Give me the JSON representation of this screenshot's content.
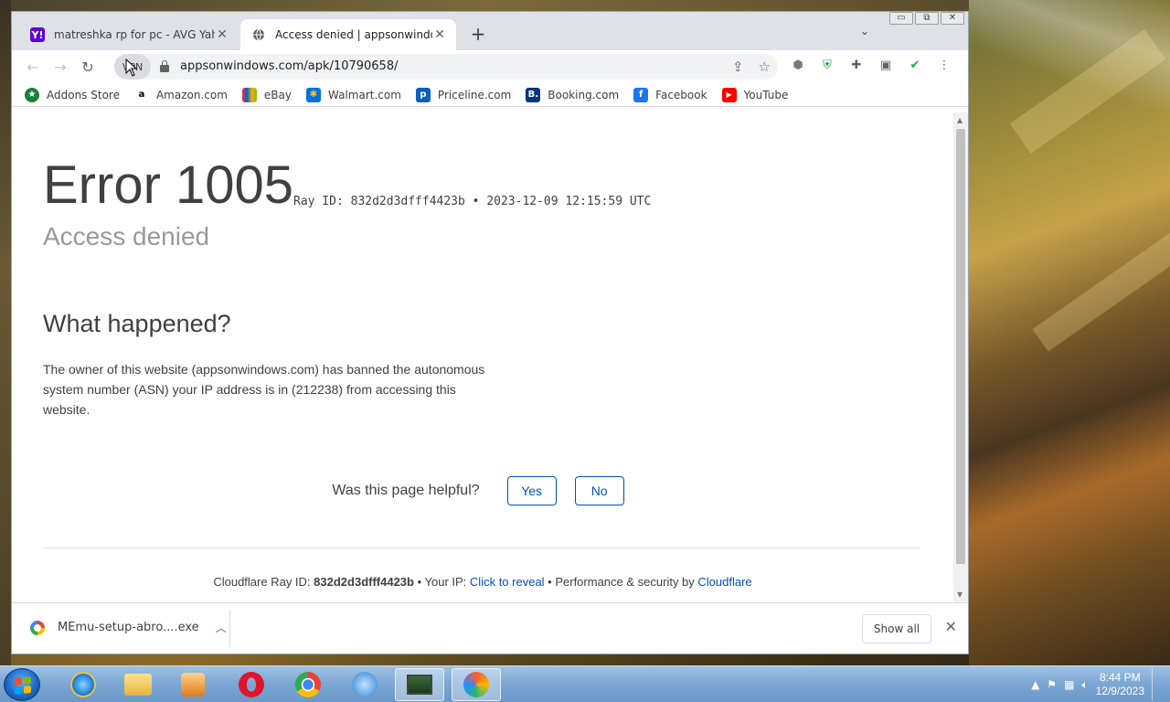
{
  "browser": {
    "tabs": [
      {
        "title": "matreshka rp for pc - AVG Yahoo",
        "favicon": "Y!",
        "favicon_color": "#6001d2",
        "active": false
      },
      {
        "title": "Access denied | appsonwindows.c",
        "favicon": "globe",
        "active": true
      }
    ],
    "new_tab_symbol": "+",
    "tab_list_symbol": "⌄",
    "window_controls": {
      "minimize": "▭",
      "restore": "⧉",
      "close": "✕"
    },
    "vpn_label": "VPN",
    "url": "appsonwindows.com/apk/10790658/",
    "bookmarks": [
      {
        "label": "Addons Store",
        "icon": "addons-icon",
        "color": "#1a7f37"
      },
      {
        "label": "Amazon.com",
        "icon": "amazon-icon",
        "color": "#000000"
      },
      {
        "label": "eBay",
        "icon": "ebay-icon",
        "color": "#e53238"
      },
      {
        "label": "Walmart.com",
        "icon": "walmart-icon",
        "color": "#0071dc"
      },
      {
        "label": "Priceline.com",
        "icon": "priceline-icon",
        "color": "#0a5dc2"
      },
      {
        "label": "Booking.com",
        "icon": "booking-icon",
        "color": "#003580"
      },
      {
        "label": "Facebook",
        "icon": "facebook-icon",
        "color": "#1877f2"
      },
      {
        "label": "YouTube",
        "icon": "youtube-icon",
        "color": "#ff0000"
      }
    ]
  },
  "page": {
    "error_title": "Error 1005",
    "ray_line": "Ray ID: 832d2d3dfff4423b • 2023-12-09 12:15:59 UTC",
    "subtitle": "Access denied",
    "what_heading": "What happened?",
    "explanation": "The owner of this website (appsonwindows.com) has banned the autonomous system number (ASN) your IP address is in (212238) from accessing this website.",
    "helpful_question": "Was this page helpful?",
    "yes_label": "Yes",
    "no_label": "No",
    "footer": {
      "ray_prefix": "Cloudflare Ray ID: ",
      "ray_id": "832d2d3dfff4423b",
      "ip_prefix": " • Your IP: ",
      "ip_link": "Click to reveal",
      "perf_prefix": " • Performance & security by ",
      "cf_link": "Cloudflare"
    },
    "link_color": "#0051c3"
  },
  "downloads": {
    "filename": "MEmu-setup-abro....exe",
    "show_all_label": "Show all"
  },
  "taskbar": {
    "time": "8:44 PM",
    "date": "12/9/2023"
  }
}
